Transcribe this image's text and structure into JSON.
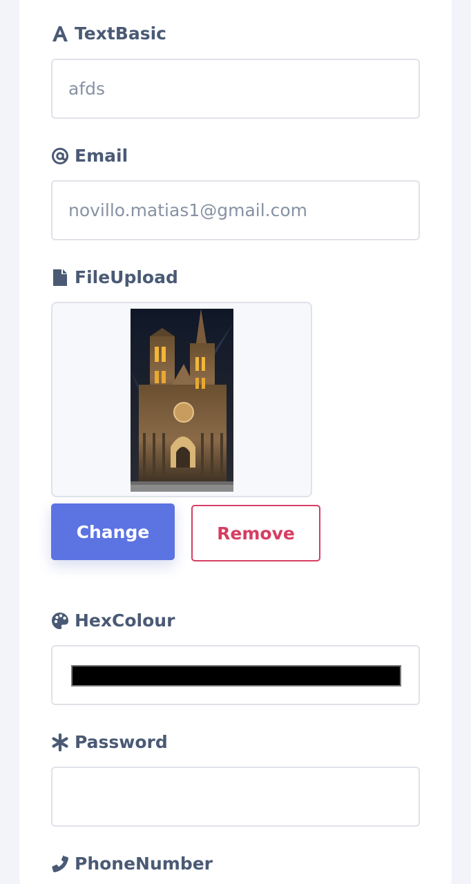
{
  "form": {
    "text_basic": {
      "label": "TextBasic",
      "icon": "font-icon",
      "value": "afds"
    },
    "email": {
      "label": "Email",
      "icon": "at-icon",
      "value": "novillo.matias1@gmail.com"
    },
    "file_upload": {
      "label": "FileUpload",
      "icon": "file-icon",
      "preview": "cathedral-night-photo",
      "change_label": "Change",
      "remove_label": "Remove"
    },
    "hex_colour": {
      "label": "HexColour",
      "icon": "palette-icon",
      "value": "#000000"
    },
    "password": {
      "label": "Password",
      "icon": "asterisk-icon",
      "value": ""
    },
    "phone_number": {
      "label": "PhoneNumber",
      "icon": "phone-icon"
    }
  },
  "colors": {
    "background": "#f2f4f9",
    "card": "#ffffff",
    "label_text": "#4a5a75",
    "input_border": "#dfe2e8",
    "input_text": "#8692a3",
    "primary_button": "#5c73e2",
    "danger": "#d63d62"
  }
}
